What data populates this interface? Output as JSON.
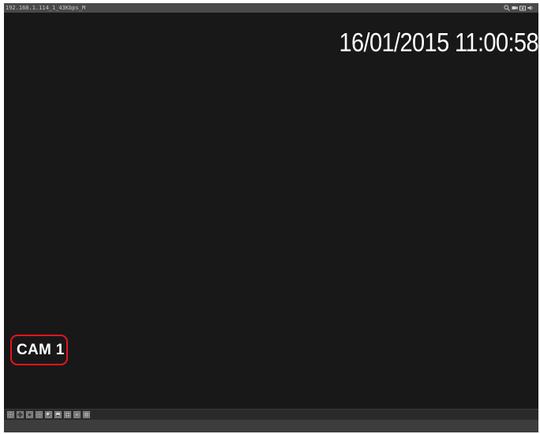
{
  "titlebar": {
    "stream_info": "192.168.1.114_1_43Kbps_M",
    "tools": [
      "zoom-icon",
      "record-icon",
      "snapshot-icon",
      "audio-icon"
    ],
    "highlight_color": "#e8141c"
  },
  "video": {
    "timestamp": "16/01/2015 11:00:58",
    "camera_name": "CAM 1",
    "background_color": "#181818"
  },
  "toolbar": {
    "buttons": [
      "full-grid-icon",
      "fullscreen-icon",
      "single-view-icon",
      "quad-view-icon",
      "six-view-icon",
      "eight-view-icon",
      "nine-view-icon",
      "thirteen-view-icon",
      "sixteen-view-icon"
    ]
  }
}
